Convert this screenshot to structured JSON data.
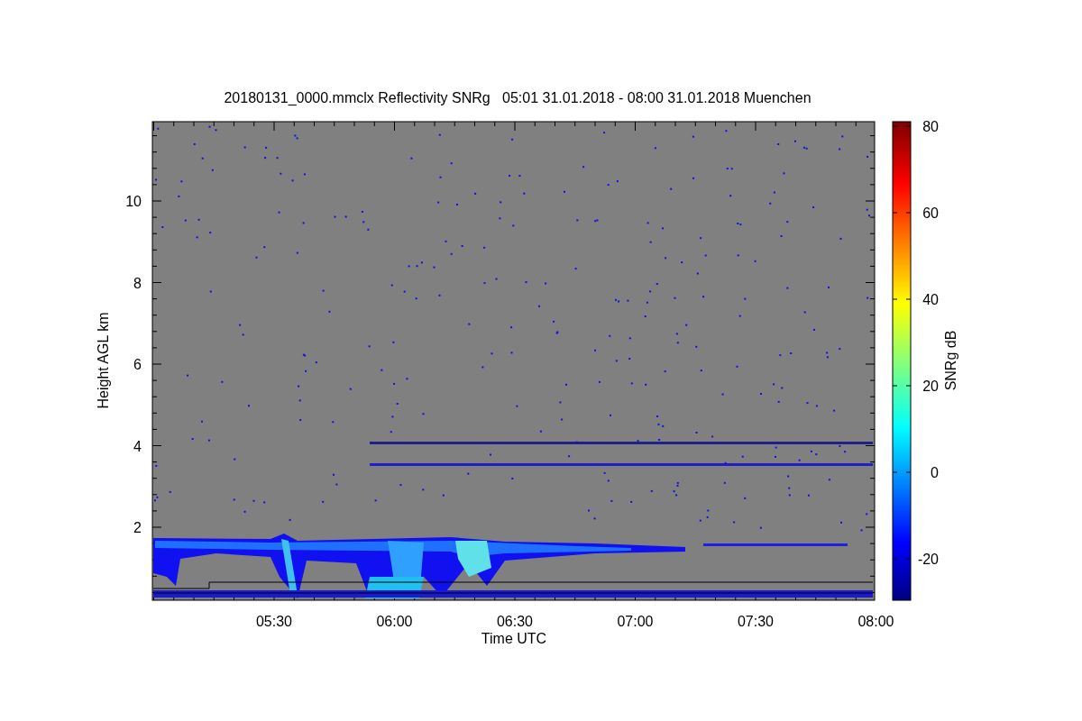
{
  "title": "20180131_0000.mmclx Reflectivity SNRg   05:01 31.01.2018 - 08:00 31.01.2018 Muenchen",
  "y_axis": {
    "label": "Height AGL km",
    "ticks": [
      "10",
      "8",
      "6",
      "4",
      "2"
    ]
  },
  "x_axis": {
    "label": "Time UTC",
    "ticks": [
      "05:30",
      "06:00",
      "06:30",
      "07:00",
      "07:30",
      "08:00"
    ]
  },
  "colorbar": {
    "label": "SNRg dB",
    "ticks": [
      "80",
      "60",
      "40",
      "20",
      "0",
      "-20"
    ]
  }
}
